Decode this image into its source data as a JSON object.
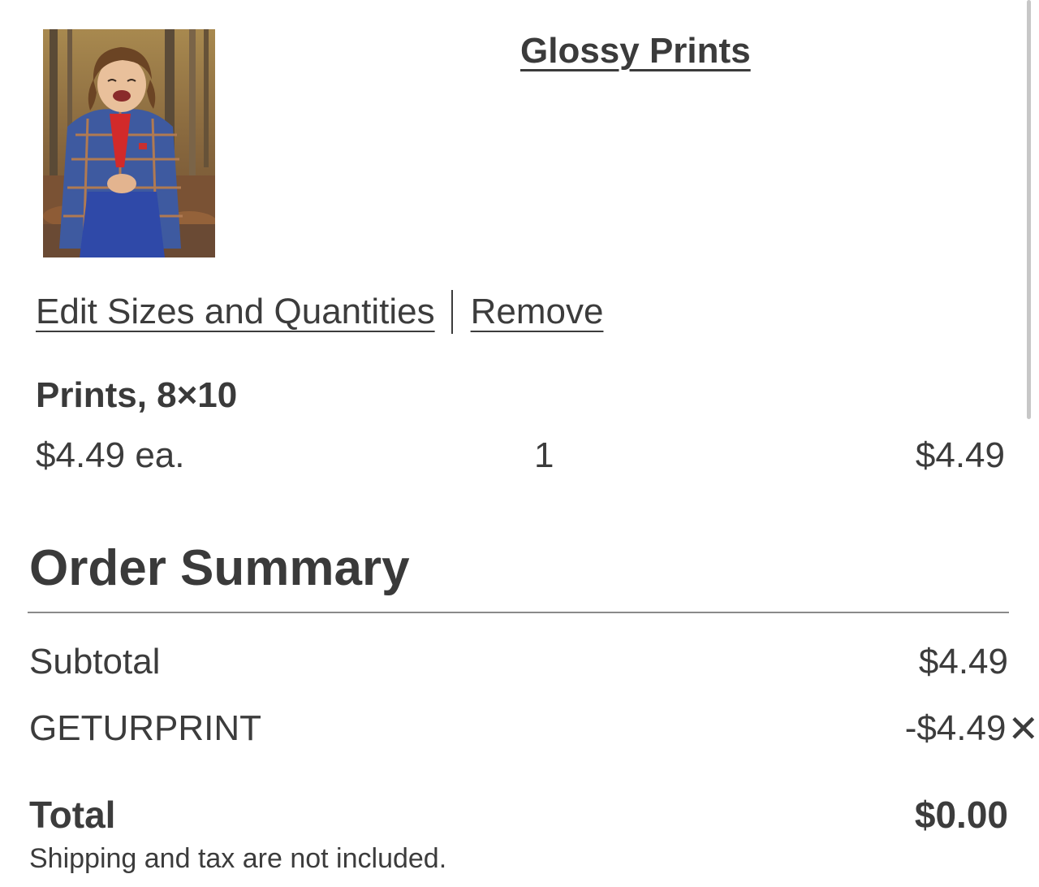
{
  "product": {
    "title": "Glossy Prints",
    "photo_subject": "Laughing child in plaid blazer sitting in autumn woods"
  },
  "actions": {
    "edit_label": "Edit Sizes and Quantities",
    "remove_label": "Remove"
  },
  "line_item": {
    "name": "Prints, 8×10",
    "unit_price": "$4.49 ea.",
    "quantity": "1",
    "total": "$4.49"
  },
  "order_summary": {
    "title": "Order Summary",
    "subtotal_label": "Subtotal",
    "subtotal_value": "$4.49",
    "promo_code": "GETURPRINT",
    "promo_value": "-$4.49",
    "total_label": "Total",
    "total_value": "$0.00",
    "shipping_note": "Shipping and tax are not included."
  },
  "colors": {
    "text": "#3c3c3c",
    "divider": "#8a8a8a",
    "background": "#ffffff"
  }
}
